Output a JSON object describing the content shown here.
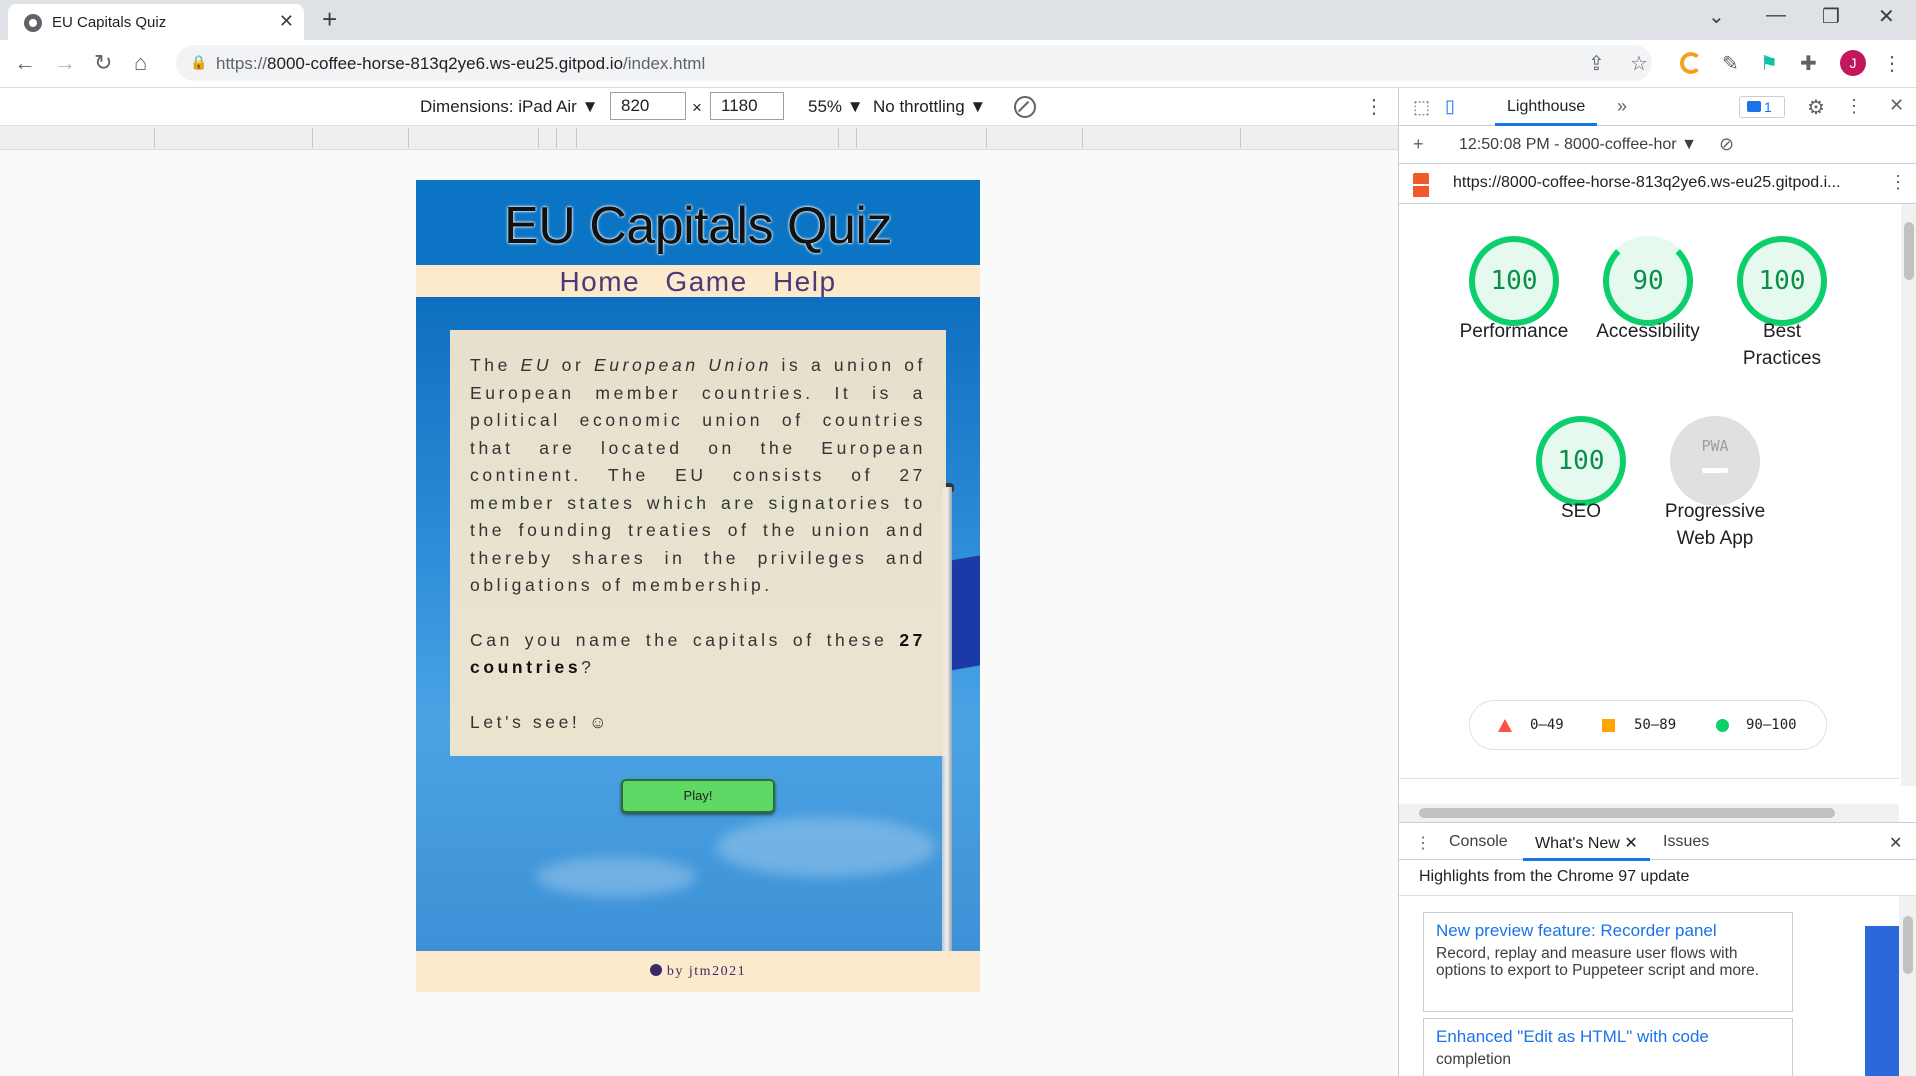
{
  "browser": {
    "tab_title": "EU Capitals Quiz",
    "new_tab_symbol": "+",
    "url_prefix": "https://",
    "url_host": "8000-coffee-horse-813q2ye6.ws-eu25.gitpod.io",
    "url_path": "/index.html",
    "avatar_letter": "J"
  },
  "device_toolbar": {
    "dimensions_label": "Dimensions: iPad Air ▼",
    "width": "820",
    "times": "×",
    "height": "1180",
    "zoom": "55% ▼",
    "throttling": "No throttling ▼"
  },
  "page": {
    "title": "EU Capitals Quiz",
    "nav": [
      "Home",
      "Game",
      "Help"
    ],
    "intro_1": "The",
    "intro_eu": "EU",
    "intro_or": "or",
    "intro_eu_full": "European Union",
    "intro_rest": "is a union of European member countries. It is a political economic union of countries that are located on the European continent. The EU consists of 27 member states which are signatories to the founding treaties of the union and thereby shares in the privileges and obligations of membership.",
    "question_pre": "Can you name the capitals of these",
    "question_bold": "27 countries",
    "question_post": "?",
    "lets_see": "Let's see! ☺",
    "play_button": "Play!",
    "footer": "by jtm2021"
  },
  "devtools": {
    "panel_tab": "Lighthouse",
    "more_tabs": "»",
    "issues_count": "1",
    "report_time": "12:50:08 PM - 8000-coffee-hor ▼",
    "report_url": "https://8000-coffee-horse-813q2ye6.ws-eu25.gitpod.i...",
    "scores": [
      {
        "value": "100",
        "label": "Performance"
      },
      {
        "value": "90",
        "label": "Accessibility"
      },
      {
        "value": "100",
        "label": "Best Practices"
      },
      {
        "value": "100",
        "label": "SEO"
      },
      {
        "value": "PWA",
        "label": "Progressive Web App"
      }
    ],
    "big_score": "100",
    "legend": {
      "fail": "0–49",
      "average": "50–89",
      "pass": "90–100"
    },
    "drawer_tabs": [
      "Console",
      "What's New",
      "Issues"
    ],
    "whats_new_heading": "Highlights from the Chrome 97 update",
    "cards": [
      {
        "title": "New preview feature: Recorder panel",
        "desc": "Record, replay and measure user flows with options to export to Puppeteer script and more."
      },
      {
        "title": "Enhanced \"Edit as HTML\" with code",
        "desc": "completion"
      }
    ]
  }
}
